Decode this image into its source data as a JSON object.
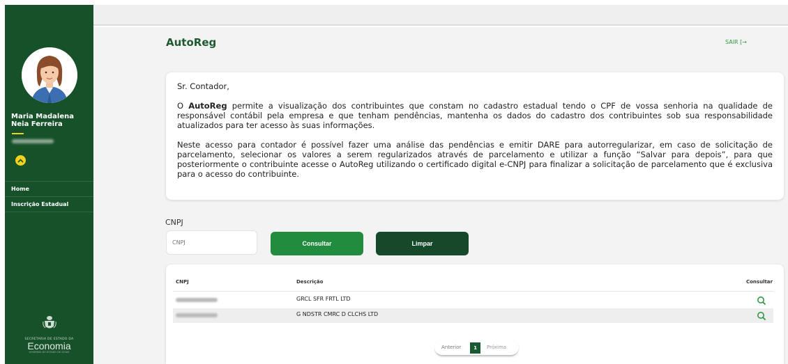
{
  "sidebar": {
    "user_name": "Maria Madalena Neia Ferreira",
    "nav": [
      {
        "label": "Home"
      },
      {
        "label": "Inscrição Estadual"
      }
    ],
    "logo": {
      "sub": "SECRETARIA DE ESTADO DA",
      "main": "Economia",
      "foot": "GOVERNO DO ESTADO DE GOIÁS"
    }
  },
  "header": {
    "title": "AutoReg",
    "logout": "SAIR [→"
  },
  "info": {
    "greeting": "Sr. Contador,",
    "p1_prefix": "O ",
    "p1_brand": "AutoReg",
    "p1_rest": " permite a visualização dos contribuintes que constam no cadastro estadual tendo o CPF de vossa senhoria na qualidade de responsável contábil pela empresa e que tenham pendências, mantenha os dados do cadastro dos contribuintes sob sua responsabilidade atualizados para ter acesso às suas informações.",
    "p2": "Neste acesso para contador é possível fazer uma análise das pendências e emitir DARE para autorregularizar, em caso de solicitação de parcelamento, selecionar os valores a serem regularizados através de parcelamento e utilizar a função “Salvar para depois”, para que posteriormente o contribuinte acesse o AutoReg utilizando o certificado digital e-CNPJ para finalizar a solicitação de parcelamento que é exclusiva para o acesso do contribuinte."
  },
  "search": {
    "label": "CNPJ",
    "placeholder": "CNPJ",
    "consultar": "Consultar",
    "limpar": "Limpar"
  },
  "table": {
    "headers": {
      "cnpj": "CNPJ",
      "descricao": "Descrição",
      "consultar": "Consultar"
    },
    "rows": [
      {
        "descricao": "GRCL SFR FRTL LTD"
      },
      {
        "descricao": "G NDSTR CMRC D CLCHS LTD"
      }
    ]
  },
  "pagination": {
    "prev": "Anterior",
    "current": "1",
    "next": "Próxima"
  },
  "colors": {
    "sidebar": "#17512a",
    "primary_button": "#218c3e",
    "dark_button": "#15492a",
    "accent_yellow": "#f2d21c",
    "title": "#1d5a31"
  }
}
